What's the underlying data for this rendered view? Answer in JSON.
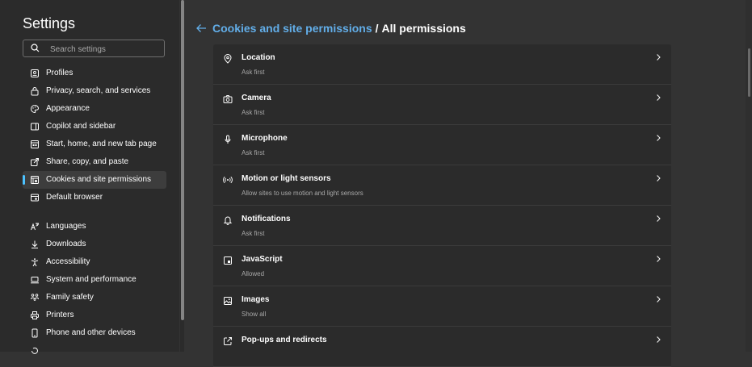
{
  "sidebar": {
    "title": "Settings",
    "search_placeholder": "Search settings",
    "items": [
      {
        "label": "Profiles",
        "icon": "profile-card-icon"
      },
      {
        "label": "Privacy, search, and services",
        "icon": "lock-icon"
      },
      {
        "label": "Appearance",
        "icon": "palette-icon"
      },
      {
        "label": "Copilot and sidebar",
        "icon": "sidebar-icon"
      },
      {
        "label": "Start, home, and new tab page",
        "icon": "home-grid-icon"
      },
      {
        "label": "Share, copy, and paste",
        "icon": "share-icon"
      },
      {
        "label": "Cookies and site permissions",
        "icon": "site-permissions-icon",
        "active": true
      },
      {
        "label": "Default browser",
        "icon": "browser-icon"
      },
      {
        "label": "Languages",
        "icon": "language-icon"
      },
      {
        "label": "Downloads",
        "icon": "download-icon"
      },
      {
        "label": "Accessibility",
        "icon": "accessibility-icon"
      },
      {
        "label": "System and performance",
        "icon": "laptop-icon"
      },
      {
        "label": "Family safety",
        "icon": "family-icon"
      },
      {
        "label": "Printers",
        "icon": "printer-icon"
      },
      {
        "label": "Phone and other devices",
        "icon": "phone-icon"
      }
    ]
  },
  "breadcrumb": {
    "parent": "Cookies and site permissions",
    "separator": "/",
    "current": "All permissions"
  },
  "permissions": [
    {
      "title": "Location",
      "subtitle": "Ask first",
      "icon": "location-pin-icon"
    },
    {
      "title": "Camera",
      "subtitle": "Ask first",
      "icon": "camera-icon"
    },
    {
      "title": "Microphone",
      "subtitle": "Ask first",
      "icon": "microphone-icon"
    },
    {
      "title": "Motion or light sensors",
      "subtitle": "Allow sites to use motion and light sensors",
      "icon": "sensor-icon"
    },
    {
      "title": "Notifications",
      "subtitle": "Ask first",
      "icon": "bell-icon"
    },
    {
      "title": "JavaScript",
      "subtitle": "Allowed",
      "icon": "javascript-icon"
    },
    {
      "title": "Images",
      "subtitle": "Show all",
      "icon": "image-icon"
    },
    {
      "title": "Pop-ups and redirects",
      "subtitle": "",
      "icon": "popup-icon"
    }
  ],
  "colors": {
    "accent": "#4cc2ff",
    "link": "#62aee9",
    "background": "#333333",
    "sidebar": "#2b2b2b"
  }
}
